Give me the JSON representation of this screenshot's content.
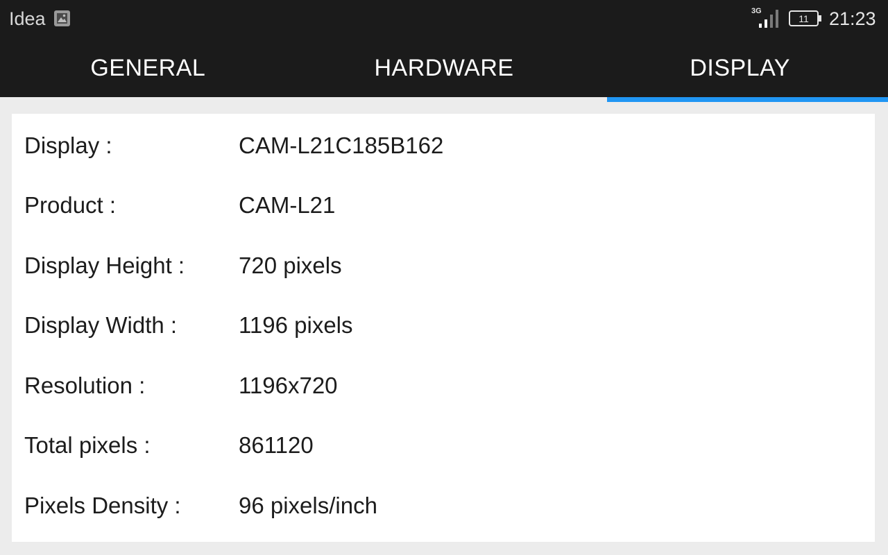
{
  "status_bar": {
    "carrier": "Idea",
    "network_type": "3G",
    "battery_level": "11",
    "time": "21:23"
  },
  "tabs": [
    {
      "label": "GENERAL",
      "selected": false
    },
    {
      "label": "HARDWARE",
      "selected": false
    },
    {
      "label": "DISPLAY",
      "selected": true
    }
  ],
  "accent_color": "#2196f3",
  "display_info": [
    {
      "label": "Display :",
      "value": "CAM-L21C185B162"
    },
    {
      "label": "Product :",
      "value": "CAM-L21"
    },
    {
      "label": "Display Height :",
      "value": "720 pixels"
    },
    {
      "label": "Display Width :",
      "value": "1196 pixels"
    },
    {
      "label": "Resolution :",
      "value": "1196x720"
    },
    {
      "label": "Total pixels :",
      "value": "861120"
    },
    {
      "label": "Pixels Density :",
      "value": "96 pixels/inch"
    }
  ]
}
